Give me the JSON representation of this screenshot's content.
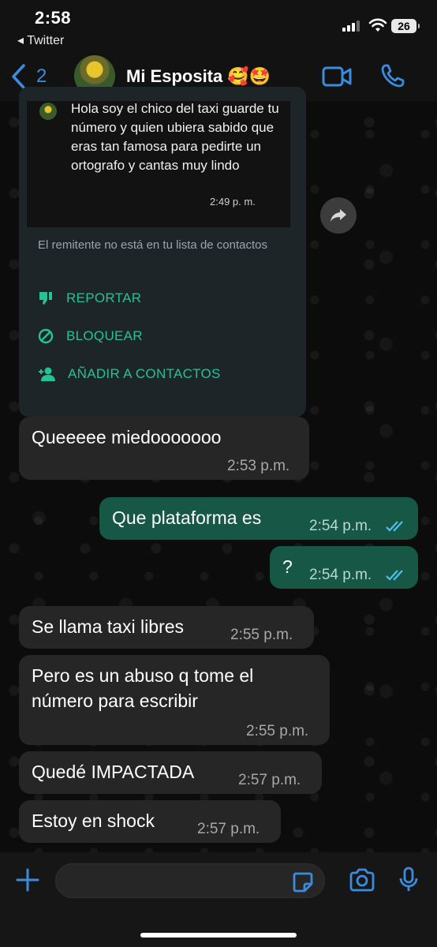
{
  "status_bar": {
    "time": "2:58",
    "back_app": "◂ Twitter",
    "battery": "26"
  },
  "header": {
    "back_count": "2",
    "contact_name": "Mi Esposita 🥰🤩"
  },
  "unknown_card": {
    "forwarded_text": "Hola soy el chico del taxi guarde tu número y quien ubiera sabido que eras tan famosa para pedirte un ortografo y cantas muy lindo",
    "forwarded_time": "2:49 p. m.",
    "note": "El remitente no está en tu lista de contactos",
    "actions": [
      {
        "label": "REPORTAR",
        "icon": "thumbs-down-icon"
      },
      {
        "label": "BLOQUEAR",
        "icon": "block-icon"
      },
      {
        "label": "AÑADIR A CONTACTOS",
        "icon": "add-contact-icon"
      }
    ]
  },
  "messages": [
    {
      "dir": "in",
      "text": "Queeeee miedooooooo",
      "time": "2:53 p.m."
    },
    {
      "dir": "out",
      "text": "Que plataforma es",
      "time": "2:54 p.m."
    },
    {
      "dir": "out",
      "text": "?",
      "time": "2:54 p.m."
    },
    {
      "dir": "in",
      "text": "Se llama taxi libres",
      "time": "2:55 p.m."
    },
    {
      "dir": "in",
      "text": "Pero es un abuso q tome el\nnúmero para escribir",
      "time": "2:55 p.m."
    },
    {
      "dir": "in",
      "text": "Quedé IMPACTADA",
      "time": "2:57 p.m."
    },
    {
      "dir": "in",
      "text": "Estoy en shock",
      "time": "2:57 p.m."
    }
  ],
  "input": {
    "placeholder": ""
  },
  "colors": {
    "accent_blue": "#3a8dde",
    "outgoing_bubble": "#165745",
    "incoming_bubble": "#262626",
    "action_green": "#25c294",
    "read_ticks": "#53bdeb"
  }
}
